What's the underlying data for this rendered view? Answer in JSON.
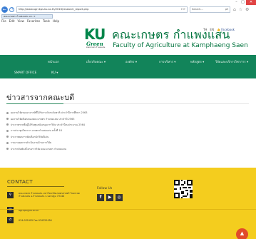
{
  "browser": {
    "window_controls": [
      "–",
      "□",
      "✕"
    ],
    "address_url": "http://www.agri.kps.ku.ac.th/2016/research_report.php",
    "address_tools": "▾ ⟳",
    "search_placeholder": "Search...",
    "search_tools": "ρ▾",
    "toolbar_icons": "⌂ ☆ ⚙",
    "tab_title": "คณะเกษตร กำแพงแสน มก. ×",
    "menu": [
      "File",
      "Edit",
      "View",
      "Favorites",
      "Tools",
      "Help"
    ]
  },
  "header": {
    "logo_ku": "KU",
    "logo_green": "Green",
    "logo_sub": "คณะเกษตร กำแพงแสน",
    "site_title_th": "คณะเกษตร กำแพงแสน",
    "site_title_en": "Faculty of Agriculture at Kamphaeng Saen",
    "lang_th": "TH",
    "lang_en": "EN",
    "facebook": "👍 Facebook"
  },
  "nav": {
    "row1": [
      "หน้าแรก",
      "เกี่ยวกับคณะ ▾",
      "องค์กร ▾",
      "การบริหาร ▾",
      "หลักสูตร ▾",
      "วิจัยและบริการวิชาการ ▾"
    ],
    "row2": [
      "SMART OFFICE",
      "KU ▾"
    ]
  },
  "news": {
    "title": "ข่าวสารจากคณะบดี",
    "items": [
      "ผลงานวิจัยของอาจารย์ที่ได้รับรางวัลระดับชาติ ประจำปีการศึกษา 2563",
      "ผลงานวิจัยดีเด่นของคณะเกษตร กำแพงแสน ประจำปี 2563",
      "ประกาศรายชื่อผู้ได้รับทุนสนับสนุนการวิจัย ประจำปีงบประมาณ 2564",
      "การประชุมวิชาการ เกษตรกำแพงแสน ครั้งที่ 18",
      "ประกาศผลการคัดเลือกนักวิจัยดีเด่น",
      "รายงานผลการดำเนินงานด้านการวิจัย",
      "ประชาสัมพันธ์โครงการวิจัย คณะเกษตร กำแพงแสน"
    ]
  },
  "footer": {
    "contact_title": "CONTACT",
    "address": "คณะเกษตร กำแพงแสน มหาวิทยาลัยเกษตรศาสตร์ วิทยาเขตกำแพงแสน อ.กำแพงแสน จ.นครปฐม 73140",
    "email": "agr.kps@ku.ac.th",
    "phone": "034-032495  Fax 034352436",
    "follow_title": "Follow Us",
    "social": [
      "f",
      "▶",
      "◎"
    ],
    "to_top": "▲"
  }
}
